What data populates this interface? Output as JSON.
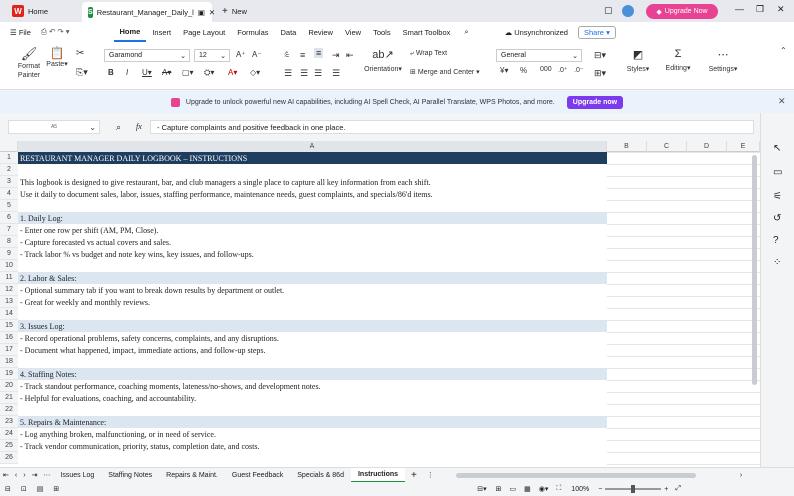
{
  "titlebar": {
    "home_tab": "Home",
    "file_tab": "Restaurant_Manager_Daily_l",
    "new_tab": "New",
    "upgrade": "Upgrade Now"
  },
  "menu": {
    "file": "File",
    "items": [
      "Home",
      "Insert",
      "Page Layout",
      "Formulas",
      "Data",
      "Review",
      "View",
      "Tools",
      "Smart Toolbox"
    ],
    "unsync": "Unsynchronized",
    "share": "Share"
  },
  "ribbon": {
    "format_painter": "Format Painter",
    "paste": "Paste",
    "font": "Garamond",
    "size": "12",
    "wrap": "Wrap Text",
    "merge": "Merge and Center",
    "orientation": "Orientation",
    "number_format": "General",
    "styles": "Styles",
    "editing": "Editing",
    "settings": "Settings"
  },
  "banner": {
    "text": "Upgrade to unlock powerful new AI capabilities, including AI Spell Check, AI Parallel Translate, WPS Photos, and more.",
    "button": "Upgrade now"
  },
  "formula_bar": {
    "name_box": "A5",
    "content": "- Capture complaints and positive feedback in one place."
  },
  "columns": [
    "A",
    "B",
    "C",
    "D",
    "E"
  ],
  "rows": [
    {
      "n": "1",
      "text": "RESTAURANT MANAGER DAILY LOGBOOK – INSTRUCTIONS",
      "style": "title"
    },
    {
      "n": "2",
      "text": "",
      "style": ""
    },
    {
      "n": "3",
      "text": "This logbook is designed to give restaurant, bar, and club managers a single place to capture all key information from each shift.",
      "style": ""
    },
    {
      "n": "4",
      "text": "Use it daily to document sales, labor, issues, staffing performance, maintenance needs, guest complaints, and specials/86'd items.",
      "style": ""
    },
    {
      "n": "5",
      "text": "",
      "style": ""
    },
    {
      "n": "6",
      "text": "1. Daily Log:",
      "style": "sec"
    },
    {
      "n": "7",
      "text": "- Enter one row per shift (AM, PM, Close).",
      "style": ""
    },
    {
      "n": "8",
      "text": "- Capture forecasted vs actual covers and sales.",
      "style": ""
    },
    {
      "n": "9",
      "text": "- Track labor % vs budget and note key wins, key issues, and follow-ups.",
      "style": ""
    },
    {
      "n": "10",
      "text": "",
      "style": ""
    },
    {
      "n": "11",
      "text": "2. Labor & Sales:",
      "style": "sec"
    },
    {
      "n": "12",
      "text": "- Optional summary tab if you want to break down results by department or outlet.",
      "style": ""
    },
    {
      "n": "13",
      "text": "- Great for weekly and monthly reviews.",
      "style": ""
    },
    {
      "n": "14",
      "text": "",
      "style": ""
    },
    {
      "n": "15",
      "text": "3. Issues Log:",
      "style": "sec"
    },
    {
      "n": "16",
      "text": "- Record operational problems, safety concerns, complaints, and any disruptions.",
      "style": ""
    },
    {
      "n": "17",
      "text": "- Document what happened, impact, immediate actions, and follow-up steps.",
      "style": ""
    },
    {
      "n": "18",
      "text": "",
      "style": ""
    },
    {
      "n": "19",
      "text": "4. Staffing Notes:",
      "style": "sec"
    },
    {
      "n": "20",
      "text": "- Track standout performance, coaching moments, lateness/no-shows, and development notes.",
      "style": ""
    },
    {
      "n": "21",
      "text": "- Helpful for evaluations, coaching, and accountability.",
      "style": ""
    },
    {
      "n": "22",
      "text": "",
      "style": ""
    },
    {
      "n": "23",
      "text": "5. Repairs & Maintenance:",
      "style": "sec"
    },
    {
      "n": "24",
      "text": "- Log anything broken, malfunctioning, or in need of service.",
      "style": ""
    },
    {
      "n": "25",
      "text": "- Track vendor communication, priority, status, completion date, and costs.",
      "style": ""
    },
    {
      "n": "26",
      "text": "",
      "style": ""
    }
  ],
  "sheets": [
    "Issues Log",
    "Staffing Notes",
    "Repairs & Maint.",
    "Guest Feedback",
    "Specials & 86d",
    "Instructions"
  ],
  "active_sheet": "Instructions",
  "status": {
    "zoom": "100%"
  }
}
